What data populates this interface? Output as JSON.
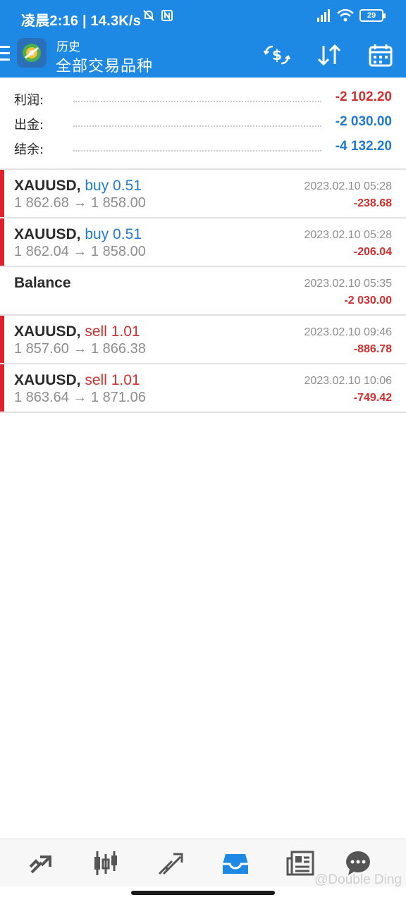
{
  "status_bar": {
    "time_speed": "凌晨2:16 | 14.3K/s",
    "battery": "29"
  },
  "app_bar": {
    "subtitle": "历史",
    "title": "全部交易品种"
  },
  "summary": [
    {
      "label": "利润:",
      "value": "-2 102.20",
      "color": "#d32f2f"
    },
    {
      "label": "出金:",
      "value": "-2 030.00",
      "color": "#1e7ad6"
    },
    {
      "label": "结余:",
      "value": "-4 132.20",
      "color": "#1e7ad6"
    }
  ],
  "deals": [
    {
      "symbol": "XAUUSD,",
      "type": "buy 0.51",
      "prices": "1 862.68 → 1 858.00",
      "time": "2023.02.10 05:28",
      "profit": "-238.68"
    },
    {
      "symbol": "XAUUSD,",
      "type": "buy 0.51",
      "prices": "1 862.04 → 1 858.00",
      "time": "2023.02.10 05:28",
      "profit": "-206.04"
    },
    {
      "symbol": "Balance",
      "type": "",
      "prices": "",
      "time": "2023.02.10 05:35",
      "profit": "-2 030.00"
    },
    {
      "symbol": "XAUUSD,",
      "type": "sell 1.01",
      "prices": "1 857.60 → 1 866.38",
      "time": "2023.02.10 09:46",
      "profit": "-886.78"
    },
    {
      "symbol": "XAUUSD,",
      "type": "sell 1.01",
      "prices": "1 863.64 → 1 871.06",
      "time": "2023.02.10 10:06",
      "profit": "-749.42"
    }
  ],
  "bottom_nav": [
    {
      "icon": "quotes-icon"
    },
    {
      "icon": "chart-candles-icon"
    },
    {
      "icon": "trade-icon"
    },
    {
      "icon": "history-inbox-icon",
      "active": true
    },
    {
      "icon": "news-icon"
    },
    {
      "icon": "chat-icon"
    }
  ],
  "watermark": "@Double Ding",
  "colors": {
    "accent": "#1e88e5",
    "loss": "#d32f2f",
    "info": "#1e7ad6"
  }
}
